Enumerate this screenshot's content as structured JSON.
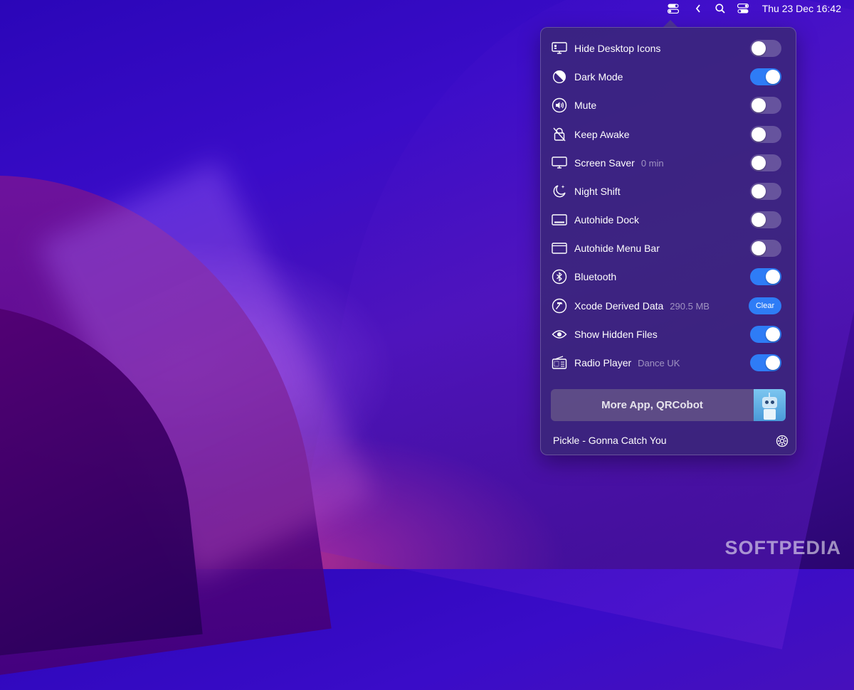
{
  "menubar": {
    "icons": [
      "toggle-menu-icon",
      "chevron-left-icon",
      "search-icon",
      "control-center-icon"
    ],
    "clock": "Thu 23 Dec  16:42"
  },
  "items": [
    {
      "label": "Hide Desktop Icons",
      "sub": "",
      "icon": "display-icon",
      "control": "toggle",
      "on": false
    },
    {
      "label": "Dark Mode",
      "sub": "",
      "icon": "dark-mode-icon",
      "control": "toggle",
      "on": true
    },
    {
      "label": "Mute",
      "sub": "",
      "icon": "speaker-icon",
      "control": "toggle",
      "on": false
    },
    {
      "label": "Keep Awake",
      "sub": "",
      "icon": "lock-slash-icon",
      "control": "toggle",
      "on": false
    },
    {
      "label": "Screen Saver",
      "sub": "0 min",
      "icon": "monitor-icon",
      "control": "toggle",
      "on": false
    },
    {
      "label": "Night Shift",
      "sub": "",
      "icon": "moon-icon",
      "control": "toggle",
      "on": false
    },
    {
      "label": "Autohide Dock",
      "sub": "",
      "icon": "dock-icon",
      "control": "toggle",
      "on": false
    },
    {
      "label": "Autohide Menu Bar",
      "sub": "",
      "icon": "menubar-icon",
      "control": "toggle",
      "on": false
    },
    {
      "label": "Bluetooth",
      "sub": "",
      "icon": "bluetooth-icon",
      "control": "toggle",
      "on": true
    },
    {
      "label": "Xcode Derived Data",
      "sub": "290.5 MB",
      "icon": "hammer-icon",
      "control": "button",
      "button_label": "Clear"
    },
    {
      "label": "Show Hidden Files",
      "sub": "",
      "icon": "eye-icon",
      "control": "toggle",
      "on": true
    },
    {
      "label": "Radio Player",
      "sub": "Dance UK",
      "icon": "radio-icon",
      "control": "toggle",
      "on": true
    }
  ],
  "promo": {
    "label": "More App, QRCobot",
    "image": "qrcobot-robot-icon"
  },
  "now_playing": "Pickle - Gonna Catch You",
  "watermark": "SOFTPEDIA",
  "colors": {
    "accent": "#2e7cf6",
    "toggle_off": "#5e4f8f",
    "panel": "#3a2678"
  }
}
